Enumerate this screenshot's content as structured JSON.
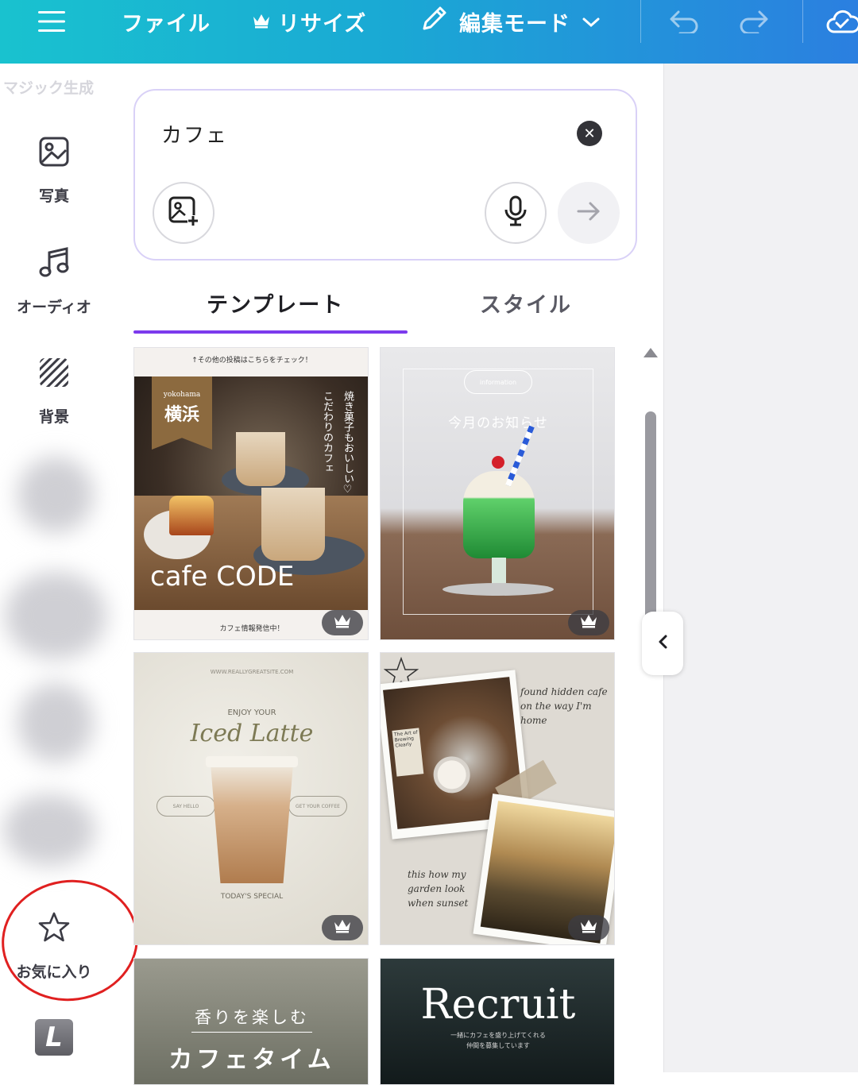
{
  "topbar": {
    "menu_icon": "hamburger-icon",
    "file_label": "ファイル",
    "resize_label": "リサイズ",
    "resize_icon": "crown-icon",
    "edit_mode_label": "編集モード",
    "edit_icon": "pencil-icon",
    "undo_icon": "undo-icon",
    "redo_icon": "redo-icon",
    "sync_icon": "cloud-check-icon"
  },
  "sidebar": {
    "faded_label": "マジック生成",
    "items": [
      {
        "label": "写真",
        "icon": "photo-icon"
      },
      {
        "label": "オーディオ",
        "icon": "music-note-icon"
      },
      {
        "label": "背景",
        "icon": "background-pattern-icon"
      },
      {
        "label": "お気に入り",
        "icon": "star-icon"
      }
    ],
    "app_badge": "L"
  },
  "search": {
    "value": "カフェ",
    "clear_icon": "close-icon",
    "image_upload_icon": "image-add-icon",
    "mic_icon": "microphone-icon",
    "submit_icon": "arrow-right-icon"
  },
  "tabs": [
    {
      "label": "テンプレート",
      "active": true
    },
    {
      "label": "スタイル",
      "active": false
    }
  ],
  "templates": [
    {
      "top_text": "↑その他の投稿はこちらをチェック！",
      "tag_small": "yokohama",
      "tag_big": "横浜",
      "vertical_1": "焼き菓子もおいしい♡",
      "vertical_2": "こだわりのカフェ",
      "logo": "cafe CODE",
      "bottom_text": "カフェ情報発信中！",
      "premium": true
    },
    {
      "pill": "information",
      "headline": "今月のお知らせ",
      "premium": true
    },
    {
      "url": "WWW.REALLYGREATSITE.COM",
      "subtitle": "ENJOY YOUR",
      "headline": "Iced Latte",
      "left_pill": "SAY HELLO",
      "right_pill": "GET YOUR COFFEE",
      "footer": "TODAY'S SPECIAL",
      "premium": true
    },
    {
      "script_1": "found hidden cafe on the way I'm home",
      "script_2": "this how my garden look when sunset",
      "book_text": "The Art of Brewing Clearly",
      "premium": true
    },
    {
      "subtitle": "香りを楽しむ",
      "headline": "カフェタイム"
    },
    {
      "headline": "Recruit",
      "sub_1": "一緒にカフェを盛り上げてくれる",
      "sub_2": "仲間を募集しています"
    }
  ],
  "panel": {
    "collapse_icon": "chevron-left-icon"
  },
  "colors": {
    "topbar_start": "#19c2cf",
    "topbar_end": "#2b7fe0",
    "tab_accent": "#7c3aed",
    "annotation": "#e02020"
  }
}
